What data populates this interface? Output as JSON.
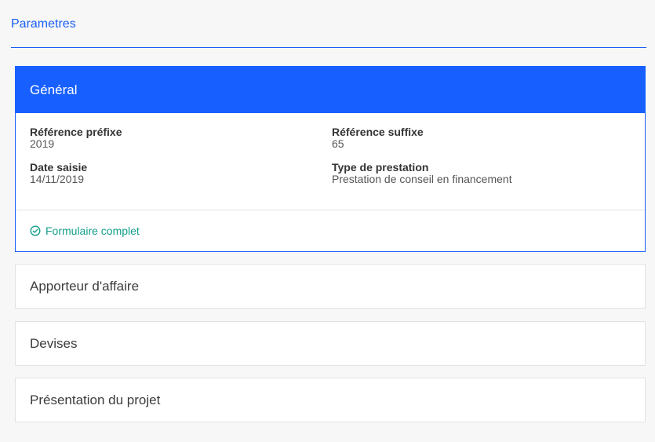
{
  "section": {
    "title": "Parametres"
  },
  "general": {
    "header": "Général",
    "fields": {
      "ref_prefix": {
        "label": "Référence préfixe",
        "value": "2019"
      },
      "ref_suffix": {
        "label": "Référence suffixe",
        "value": "65"
      },
      "date_saisie": {
        "label": "Date saisie",
        "value": "14/11/2019"
      },
      "type_prestation": {
        "label": "Type de prestation",
        "value": "Prestation de conseil en financement"
      }
    },
    "status": {
      "text": "Formulaire complet",
      "icon": "check-circle-icon"
    }
  },
  "cards": [
    {
      "label": "Apporteur d'affaire"
    },
    {
      "label": "Devises"
    },
    {
      "label": "Présentation du projet"
    }
  ],
  "colors": {
    "accent": "#1760ff",
    "title": "#1a5ff0",
    "success": "#139e8a",
    "background": "#f7f7f7"
  }
}
